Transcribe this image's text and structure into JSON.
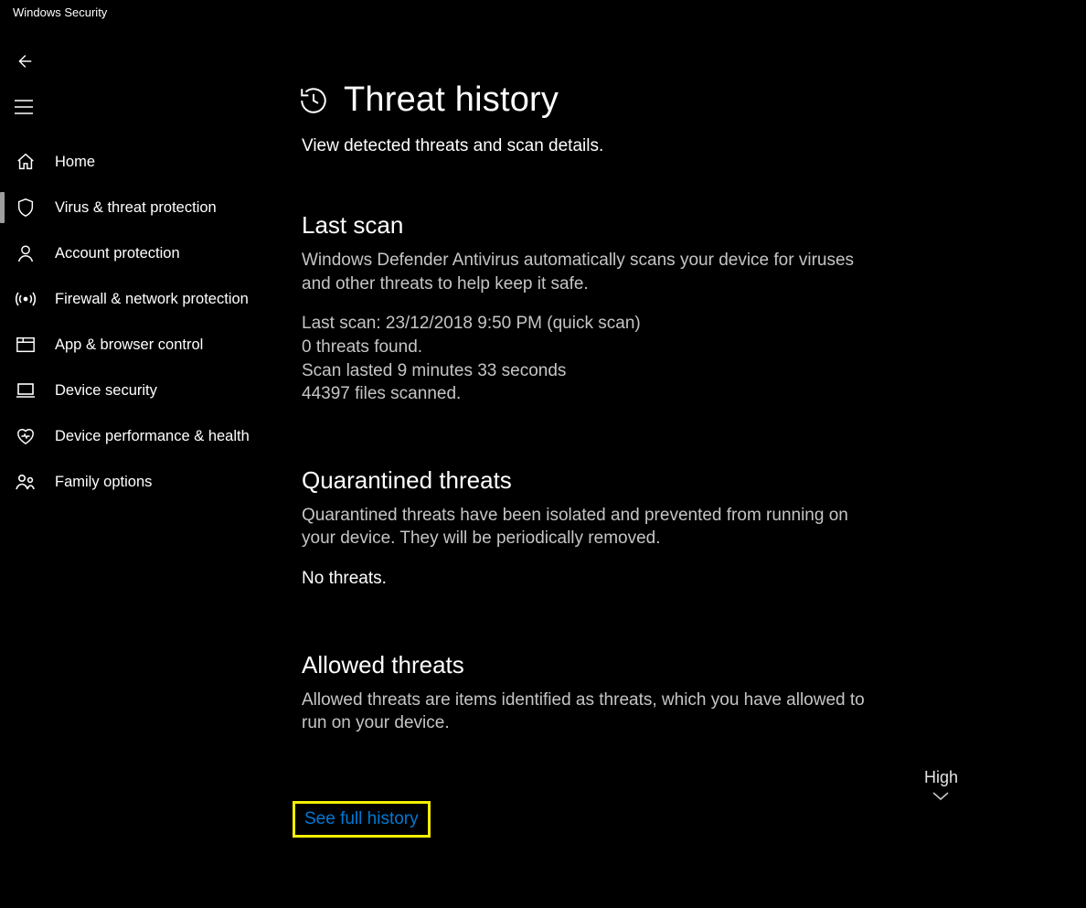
{
  "app": {
    "title": "Windows Security"
  },
  "nav": {
    "items": [
      {
        "label": "Home"
      },
      {
        "label": "Virus & threat protection"
      },
      {
        "label": "Account protection"
      },
      {
        "label": "Firewall & network protection"
      },
      {
        "label": "App & browser control"
      },
      {
        "label": "Device security"
      },
      {
        "label": "Device performance & health"
      },
      {
        "label": "Family options"
      }
    ],
    "active_index": 1
  },
  "page": {
    "title": "Threat history",
    "subtitle": "View detected threats and scan details."
  },
  "sections": {
    "last_scan": {
      "title": "Last scan",
      "desc": "Windows Defender Antivirus automatically scans your device for viruses and other threats to help keep it safe.",
      "lines": [
        "Last scan: 23/12/2018 9:50 PM (quick scan)",
        "0 threats found.",
        "Scan lasted 9 minutes 33 seconds",
        "44397 files scanned."
      ]
    },
    "quarantined": {
      "title": "Quarantined threats",
      "desc": "Quarantined threats have been isolated and prevented from running on your device. They will be periodically removed.",
      "status": "No threats."
    },
    "allowed": {
      "title": "Allowed threats",
      "desc": "Allowed threats are items identified as threats, which you have allowed to run on your device.",
      "level": "High"
    }
  },
  "actions": {
    "see_full_history": "See full history"
  },
  "colors": {
    "link": "#0078d4",
    "highlight": "#f6ee00"
  }
}
